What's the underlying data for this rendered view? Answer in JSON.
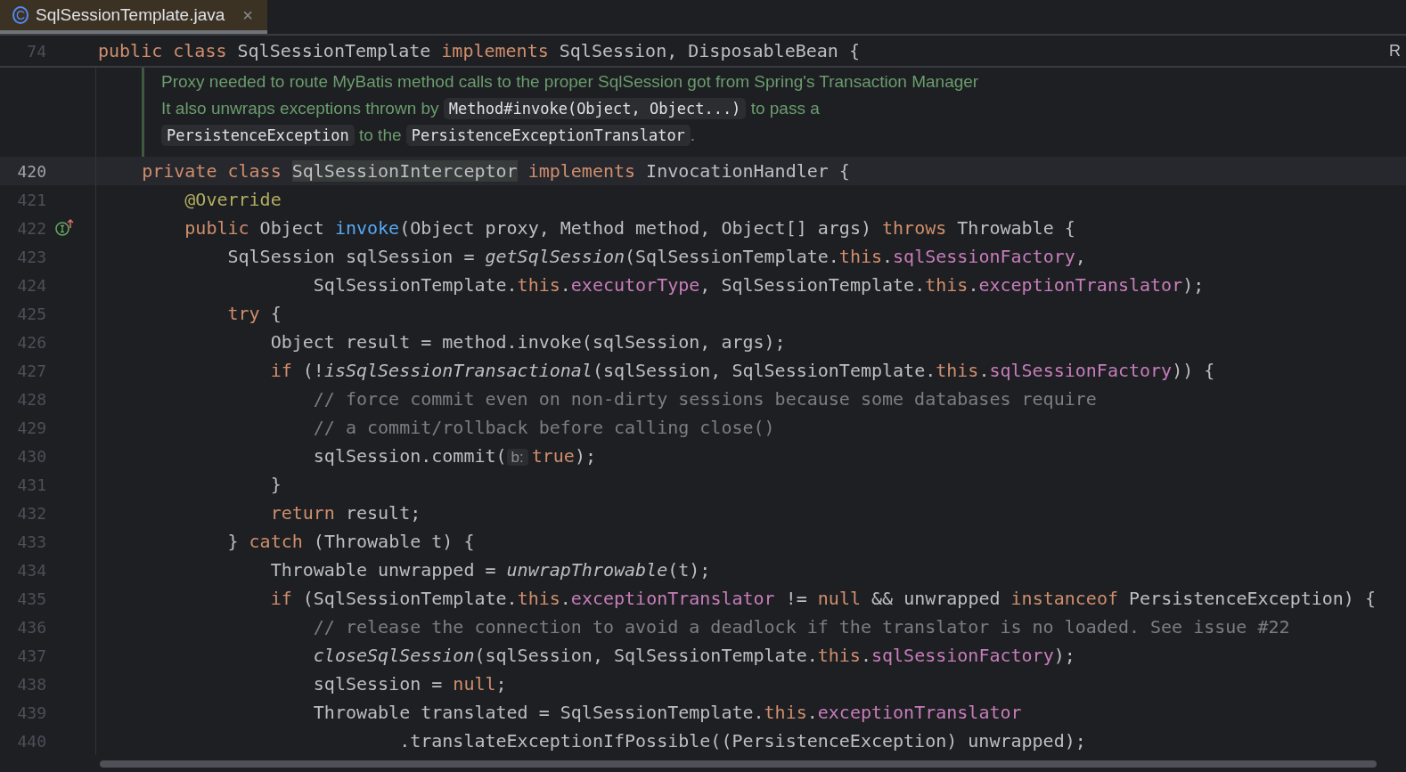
{
  "tab": {
    "title": "SqlSessionTemplate.java",
    "icon_letter": "C",
    "close": "×",
    "selected": true
  },
  "sticky": {
    "number": "74",
    "segments": [
      {
        "text": "public",
        "kind": "keyword"
      },
      {
        "text": " class",
        "kind": "keyword"
      },
      {
        "text": " SqlSessionTemplate ",
        "kind": "plain"
      },
      {
        "text": "implements",
        "kind": "keyword"
      },
      {
        "text": " SqlSession, DisposableBean {",
        "kind": "plain"
      }
    ],
    "edge_text": "R"
  },
  "doc": [
    {
      "text": "Proxy needed to route MyBatis method calls to the proper SqlSession got from Spring's Transaction Manager It also unwraps exceptions thrown by ",
      "kind": "text"
    },
    {
      "text": "Method#invoke(Object, Object...)",
      "kind": "code"
    },
    {
      "text": " to pass a ",
      "kind": "text"
    },
    {
      "text": "PersistenceException",
      "kind": "code"
    },
    {
      "text": " to the ",
      "kind": "text"
    },
    {
      "text": "PersistenceExceptionTranslator",
      "kind": "code"
    },
    {
      "text": ".",
      "kind": "text"
    }
  ],
  "lines": [
    {
      "number": "420",
      "current": true,
      "kind": "plain",
      "segments": [
        {
          "text": "    private class ",
          "kind": "keyword"
        },
        {
          "text": "SqlSessionInterceptor",
          "kind": "highlight"
        },
        {
          "text": " implements",
          "kind": "keyword"
        },
        {
          "text": " InvocationHandler {",
          "kind": "plain"
        }
      ]
    },
    {
      "number": "421",
      "current": false,
      "kind": "plain",
      "segments": [
        {
          "text": "        @Override",
          "kind": "annotation"
        }
      ]
    },
    {
      "number": "422",
      "current": false,
      "kind": "implementing",
      "segments": [
        {
          "text": "        public",
          "kind": "keyword"
        },
        {
          "text": " Object ",
          "kind": "plain"
        },
        {
          "text": "invoke",
          "kind": "method"
        },
        {
          "text": "(Object proxy, Method method, Object[] args) ",
          "kind": "plain"
        },
        {
          "text": "throws",
          "kind": "keyword"
        },
        {
          "text": " Throwable {",
          "kind": "plain"
        }
      ]
    },
    {
      "number": "423",
      "current": false,
      "kind": "plain",
      "segments": [
        {
          "text": "            SqlSession sqlSession = ",
          "kind": "plain"
        },
        {
          "text": "getSqlSession",
          "kind": "static"
        },
        {
          "text": "(SqlSessionTemplate.",
          "kind": "plain"
        },
        {
          "text": "this",
          "kind": "keyword"
        },
        {
          "text": ".",
          "kind": "plain"
        },
        {
          "text": "sqlSessionFactory",
          "kind": "field"
        },
        {
          "text": ",",
          "kind": "plain"
        }
      ]
    },
    {
      "number": "424",
      "current": false,
      "kind": "plain",
      "segments": [
        {
          "text": "                    SqlSessionTemplate.",
          "kind": "plain"
        },
        {
          "text": "this",
          "kind": "keyword"
        },
        {
          "text": ".",
          "kind": "plain"
        },
        {
          "text": "executorType",
          "kind": "field"
        },
        {
          "text": ", SqlSessionTemplate.",
          "kind": "plain"
        },
        {
          "text": "this",
          "kind": "keyword"
        },
        {
          "text": ".",
          "kind": "plain"
        },
        {
          "text": "exceptionTranslator",
          "kind": "field"
        },
        {
          "text": ");",
          "kind": "plain"
        }
      ]
    },
    {
      "number": "425",
      "current": false,
      "kind": "plain",
      "segments": [
        {
          "text": "            try",
          "kind": "keyword"
        },
        {
          "text": " {",
          "kind": "plain"
        }
      ]
    },
    {
      "number": "426",
      "current": false,
      "kind": "plain",
      "segments": [
        {
          "text": "                Object result = method.invoke(sqlSession, args);",
          "kind": "plain"
        }
      ]
    },
    {
      "number": "427",
      "current": false,
      "kind": "plain",
      "segments": [
        {
          "text": "                if",
          "kind": "keyword"
        },
        {
          "text": " (!",
          "kind": "plain"
        },
        {
          "text": "isSqlSessionTransactional",
          "kind": "static"
        },
        {
          "text": "(sqlSession, SqlSessionTemplate.",
          "kind": "plain"
        },
        {
          "text": "this",
          "kind": "keyword"
        },
        {
          "text": ".",
          "kind": "plain"
        },
        {
          "text": "sqlSessionFactory",
          "kind": "field"
        },
        {
          "text": ")) {",
          "kind": "plain"
        }
      ]
    },
    {
      "number": "428",
      "current": false,
      "kind": "plain",
      "segments": [
        {
          "text": "                    // force commit even on non-dirty sessions because some databases require",
          "kind": "comment"
        }
      ]
    },
    {
      "number": "429",
      "current": false,
      "kind": "plain",
      "segments": [
        {
          "text": "                    // a commit/rollback before calling close()",
          "kind": "comment"
        }
      ]
    },
    {
      "number": "430",
      "current": false,
      "kind": "plain",
      "segments": [
        {
          "text": "                    sqlSession.commit(",
          "kind": "plain"
        },
        {
          "text": "b:",
          "kind": "hint"
        },
        {
          "text": "true",
          "kind": "keyword"
        },
        {
          "text": ");",
          "kind": "plain"
        }
      ]
    },
    {
      "number": "431",
      "current": false,
      "kind": "plain",
      "segments": [
        {
          "text": "                }",
          "kind": "plain"
        }
      ]
    },
    {
      "number": "432",
      "current": false,
      "kind": "plain",
      "segments": [
        {
          "text": "                return",
          "kind": "keyword"
        },
        {
          "text": " result;",
          "kind": "plain"
        }
      ]
    },
    {
      "number": "433",
      "current": false,
      "kind": "plain",
      "segments": [
        {
          "text": "            } ",
          "kind": "plain"
        },
        {
          "text": "catch",
          "kind": "keyword"
        },
        {
          "text": " (Throwable t) {",
          "kind": "plain"
        }
      ]
    },
    {
      "number": "434",
      "current": false,
      "kind": "plain",
      "segments": [
        {
          "text": "                Throwable unwrapped = ",
          "kind": "plain"
        },
        {
          "text": "unwrapThrowable",
          "kind": "static"
        },
        {
          "text": "(t);",
          "kind": "plain"
        }
      ]
    },
    {
      "number": "435",
      "current": false,
      "kind": "plain",
      "segments": [
        {
          "text": "                if",
          "kind": "keyword"
        },
        {
          "text": " (SqlSessionTemplate.",
          "kind": "plain"
        },
        {
          "text": "this",
          "kind": "keyword"
        },
        {
          "text": ".",
          "kind": "plain"
        },
        {
          "text": "exceptionTranslator",
          "kind": "field"
        },
        {
          "text": " != ",
          "kind": "plain"
        },
        {
          "text": "null",
          "kind": "keyword"
        },
        {
          "text": " && unwrapped ",
          "kind": "plain"
        },
        {
          "text": "instanceof",
          "kind": "keyword"
        },
        {
          "text": " PersistenceException) {",
          "kind": "plain"
        }
      ]
    },
    {
      "number": "436",
      "current": false,
      "kind": "plain",
      "segments": [
        {
          "text": "                    // release the connection to avoid a deadlock if the translator is no loaded. See issue #22",
          "kind": "comment"
        }
      ]
    },
    {
      "number": "437",
      "current": false,
      "kind": "plain",
      "segments": [
        {
          "text": "                    closeSqlSession",
          "kind": "static"
        },
        {
          "text": "(sqlSession, SqlSessionTemplate.",
          "kind": "plain"
        },
        {
          "text": "this",
          "kind": "keyword"
        },
        {
          "text": ".",
          "kind": "plain"
        },
        {
          "text": "sqlSessionFactory",
          "kind": "field"
        },
        {
          "text": ");",
          "kind": "plain"
        }
      ]
    },
    {
      "number": "438",
      "current": false,
      "kind": "plain",
      "segments": [
        {
          "text": "                    sqlSession = ",
          "kind": "plain"
        },
        {
          "text": "null",
          "kind": "keyword"
        },
        {
          "text": ";",
          "kind": "plain"
        }
      ]
    },
    {
      "number": "439",
      "current": false,
      "kind": "plain",
      "segments": [
        {
          "text": "                    Throwable translated = SqlSessionTemplate.",
          "kind": "plain"
        },
        {
          "text": "this",
          "kind": "keyword"
        },
        {
          "text": ".",
          "kind": "plain"
        },
        {
          "text": "exceptionTranslator",
          "kind": "field"
        }
      ]
    },
    {
      "number": "440",
      "current": false,
      "kind": "plain",
      "segments": [
        {
          "text": "                            .translateExceptionIfPossible((PersistenceException) unwrapped);",
          "kind": "plain"
        }
      ]
    }
  ]
}
